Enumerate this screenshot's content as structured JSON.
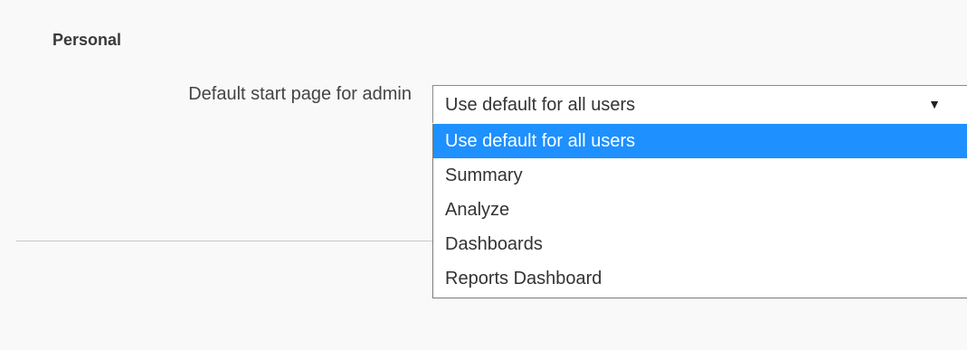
{
  "section": {
    "title": "Personal"
  },
  "field": {
    "label": "Default start page for admin",
    "selected_value": "Use default for all users",
    "arrow_icon": "▼"
  },
  "dropdown": {
    "highlight_color": "#1e90ff",
    "options": [
      {
        "label": "Use default for all users",
        "selected": true
      },
      {
        "label": "Summary",
        "selected": false
      },
      {
        "label": "Analyze",
        "selected": false
      },
      {
        "label": "Dashboards",
        "selected": false
      },
      {
        "label": "Reports Dashboard",
        "selected": false
      }
    ]
  }
}
